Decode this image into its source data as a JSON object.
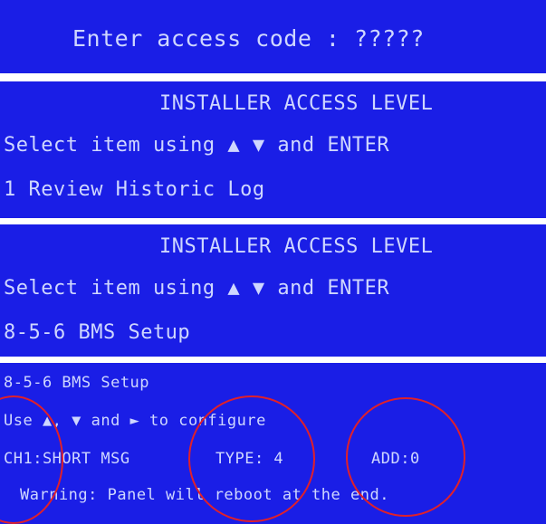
{
  "panel1": {
    "line1": "Enter access code : ?????"
  },
  "panel2": {
    "title": "INSTALLER ACCESS LEVEL",
    "instruction": "Select item using ▲ ▼ and ENTER",
    "item": "1     Review Historic Log"
  },
  "panel3": {
    "title": "INSTALLER ACCESS LEVEL",
    "instruction": "Select item using ▲ ▼ and ENTER",
    "item": "8-5-6 BMS Setup"
  },
  "panel4": {
    "header": "8-5-6 BMS Setup",
    "instruction": "Use ▲, ▼ and ► to configure",
    "channel": "CH1:SHORT MSG",
    "type": "TYPE: 4",
    "address": "ADD:0",
    "warning": "Warning: Panel will reboot at the end."
  },
  "colors": {
    "lcd_blue": "#1a1ee6",
    "text": "#cfd7ff",
    "highlight_circle": "#e0202a"
  }
}
